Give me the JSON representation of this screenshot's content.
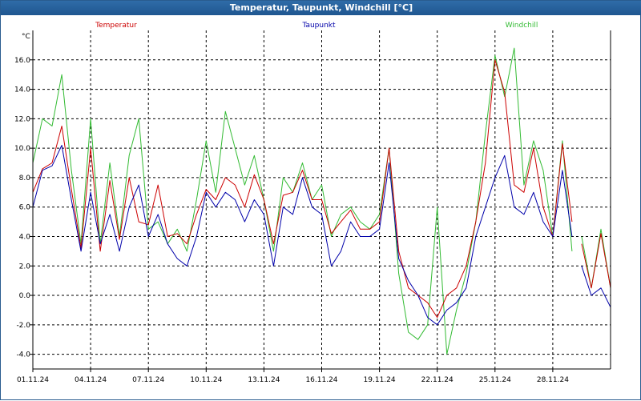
{
  "window": {
    "title": "Temperatur, Taupunkt, Windchill [°C]"
  },
  "colors": {
    "temperature": "#cc0000",
    "dewpoint": "#0000aa",
    "windchill": "#33bb33",
    "grid": "#000000",
    "title_bar": "#1f5690"
  },
  "chart_data": {
    "type": "line",
    "title": "Temperatur, Taupunkt, Windchill [°C]",
    "ylabel": "°C",
    "xlabel": "",
    "ylim": [
      -5,
      18
    ],
    "xlim": [
      "01.11.24 00:00",
      "01.12.24 00:00"
    ],
    "grid": true,
    "legend_position": "top",
    "x_ticks": [
      "01.11.24",
      "04.11.24",
      "07.11.24",
      "10.11.24",
      "13.11.24",
      "16.11.24",
      "19.11.24",
      "22.11.24",
      "25.11.24",
      "28.11.24"
    ],
    "y_ticks": [
      "-4.0",
      "-2.0",
      "0.0",
      "2.0",
      "4.0",
      "6.0",
      "8.0",
      "10.0",
      "12.0",
      "14.0",
      "16.0"
    ],
    "series": [
      {
        "name": "Temperatur",
        "x": [
          "01.11.24 00:00",
          "01.11.24 12:00",
          "02.11.24 00:00",
          "02.11.24 12:00",
          "03.11.24 00:00",
          "03.11.24 12:00",
          "04.11.24 00:00",
          "04.11.24 12:00",
          "05.11.24 00:00",
          "05.11.24 12:00",
          "06.11.24 00:00",
          "06.11.24 12:00",
          "07.11.24 00:00",
          "07.11.24 12:00",
          "08.11.24 00:00",
          "08.11.24 12:00",
          "09.11.24 00:00",
          "09.11.24 12:00",
          "10.11.24 00:00",
          "10.11.24 12:00",
          "11.11.24 00:00",
          "11.11.24 12:00",
          "12.11.24 00:00",
          "12.11.24 12:00",
          "13.11.24 00:00",
          "13.11.24 12:00",
          "14.11.24 00:00",
          "14.11.24 12:00",
          "15.11.24 00:00",
          "15.11.24 12:00",
          "16.11.24 00:00",
          "16.11.24 12:00",
          "17.11.24 00:00",
          "17.11.24 12:00",
          "18.11.24 00:00",
          "18.11.24 12:00",
          "19.11.24 00:00",
          "19.11.24 12:00",
          "20.11.24 00:00",
          "20.11.24 12:00",
          "21.11.24 00:00",
          "21.11.24 12:00",
          "22.11.24 00:00",
          "22.11.24 12:00",
          "23.11.24 00:00",
          "23.11.24 12:00",
          "24.11.24 00:00",
          "24.11.24 12:00",
          "25.11.24 00:00",
          "25.11.24 12:00",
          "26.11.24 00:00",
          "26.11.24 12:00",
          "27.11.24 00:00",
          "27.11.24 12:00",
          "28.11.24 00:00",
          "28.11.24 12:00",
          "29.11.24 00:00",
          null,
          "29.11.24 12:00",
          "30.11.24 00:00",
          "30.11.24 12:00",
          "01.12.24 00:00"
        ],
        "values": [
          7.0,
          8.6,
          9.0,
          11.5,
          7.2,
          3.2,
          10.0,
          3.0,
          7.8,
          3.8,
          8.0,
          5.0,
          4.8,
          7.5,
          4.0,
          4.2,
          3.5,
          5.5,
          7.2,
          6.5,
          8.0,
          7.5,
          6.0,
          8.2,
          6.5,
          3.5,
          6.8,
          7.0,
          8.5,
          6.5,
          6.5,
          4.2,
          5.0,
          5.8,
          4.5,
          4.5,
          5.0,
          10.0,
          3.0,
          0.5,
          0.0,
          -0.5,
          -1.5,
          0.0,
          0.5,
          2.0,
          5.0,
          9.0,
          16.0,
          13.8,
          7.5,
          7.0,
          10.0,
          6.0,
          4.0,
          10.3,
          5.0,
          null,
          3.5,
          0.5,
          4.2,
          0.5
        ]
      },
      {
        "name": "Taupunkt",
        "x": [
          "01.11.24 00:00",
          "01.11.24 12:00",
          "02.11.24 00:00",
          "02.11.24 12:00",
          "03.11.24 00:00",
          "03.11.24 12:00",
          "04.11.24 00:00",
          "04.11.24 12:00",
          "05.11.24 00:00",
          "05.11.24 12:00",
          "06.11.24 00:00",
          "06.11.24 12:00",
          "07.11.24 00:00",
          "07.11.24 12:00",
          "08.11.24 00:00",
          "08.11.24 12:00",
          "09.11.24 00:00",
          "09.11.24 12:00",
          "10.11.24 00:00",
          "10.11.24 12:00",
          "11.11.24 00:00",
          "11.11.24 12:00",
          "12.11.24 00:00",
          "12.11.24 12:00",
          "13.11.24 00:00",
          "13.11.24 12:00",
          "14.11.24 00:00",
          "14.11.24 12:00",
          "15.11.24 00:00",
          "15.11.24 12:00",
          "16.11.24 00:00",
          "16.11.24 12:00",
          "17.11.24 00:00",
          "17.11.24 12:00",
          "18.11.24 00:00",
          "18.11.24 12:00",
          "19.11.24 00:00",
          "19.11.24 12:00",
          "20.11.24 00:00",
          "20.11.24 12:00",
          "21.11.24 00:00",
          "21.11.24 12:00",
          "22.11.24 00:00",
          "22.11.24 12:00",
          "23.11.24 00:00",
          "23.11.24 12:00",
          "24.11.24 00:00",
          "24.11.24 12:00",
          "25.11.24 00:00",
          "25.11.24 12:00",
          "26.11.24 00:00",
          "26.11.24 12:00",
          "27.11.24 00:00",
          "27.11.24 12:00",
          "28.11.24 00:00",
          "28.11.24 12:00",
          "29.11.24 00:00",
          null,
          "29.11.24 12:00",
          "30.11.24 00:00",
          "30.11.24 12:00",
          "01.12.24 00:00"
        ],
        "values": [
          6.0,
          8.5,
          8.8,
          10.2,
          6.5,
          3.0,
          7.0,
          3.5,
          5.5,
          3.0,
          6.0,
          7.5,
          4.0,
          5.5,
          3.5,
          2.5,
          2.0,
          4.0,
          7.0,
          6.0,
          7.0,
          6.5,
          5.0,
          6.5,
          5.5,
          2.0,
          6.0,
          5.5,
          8.0,
          6.0,
          5.5,
          2.0,
          3.0,
          5.0,
          4.0,
          4.0,
          4.5,
          9.0,
          2.5,
          1.0,
          0.0,
          -1.5,
          -2.0,
          -1.0,
          -0.5,
          0.5,
          4.0,
          6.0,
          8.0,
          9.5,
          6.0,
          5.5,
          7.0,
          5.0,
          4.0,
          8.5,
          4.0,
          null,
          2.0,
          0.0,
          0.5,
          -0.8
        ]
      },
      {
        "name": "Windchill",
        "x": [
          "01.11.24 00:00",
          "01.11.24 12:00",
          "02.11.24 00:00",
          "02.11.24 12:00",
          "03.11.24 00:00",
          "03.11.24 12:00",
          "04.11.24 00:00",
          "04.11.24 12:00",
          "05.11.24 00:00",
          "05.11.24 12:00",
          "06.11.24 00:00",
          "06.11.24 12:00",
          "07.11.24 00:00",
          "07.11.24 12:00",
          "08.11.24 00:00",
          "08.11.24 12:00",
          "09.11.24 00:00",
          "09.11.24 12:00",
          "10.11.24 00:00",
          "10.11.24 12:00",
          "11.11.24 00:00",
          "11.11.24 12:00",
          "12.11.24 00:00",
          "12.11.24 12:00",
          "13.11.24 00:00",
          "13.11.24 12:00",
          "14.11.24 00:00",
          "14.11.24 12:00",
          "15.11.24 00:00",
          "15.11.24 12:00",
          "16.11.24 00:00",
          "16.11.24 12:00",
          "17.11.24 00:00",
          "17.11.24 12:00",
          "18.11.24 00:00",
          "18.11.24 12:00",
          "19.11.24 00:00",
          "19.11.24 12:00",
          "20.11.24 00:00",
          "20.11.24 12:00",
          "21.11.24 00:00",
          "21.11.24 12:00",
          "22.11.24 00:00",
          "22.11.24 12:00",
          "23.11.24 00:00",
          "23.11.24 12:00",
          "24.11.24 00:00",
          "24.11.24 12:00",
          "25.11.24 00:00",
          "25.11.24 12:00",
          "26.11.24 00:00",
          "26.11.24 12:00",
          "27.11.24 00:00",
          "27.11.24 12:00",
          "28.11.24 00:00",
          "28.11.24 12:00",
          "29.11.24 00:00",
          null,
          "29.11.24 12:00",
          "30.11.24 00:00",
          "30.11.24 12:00",
          "01.12.24 00:00"
        ],
        "values": [
          9.0,
          12.0,
          11.5,
          15.0,
          8.5,
          3.5,
          12.0,
          3.5,
          9.0,
          4.0,
          9.5,
          12.0,
          4.5,
          5.0,
          3.5,
          4.5,
          3.0,
          6.5,
          10.5,
          7.0,
          12.5,
          10.0,
          7.5,
          9.5,
          6.5,
          3.0,
          8.0,
          7.0,
          9.0,
          6.5,
          7.5,
          4.0,
          5.5,
          6.0,
          5.0,
          4.5,
          5.5,
          10.0,
          1.5,
          -2.5,
          -3.0,
          -2.0,
          6.0,
          -4.0,
          -1.0,
          1.5,
          5.0,
          11.0,
          16.3,
          13.5,
          16.8,
          7.5,
          10.5,
          8.5,
          4.0,
          10.5,
          3.0,
          null,
          4.0,
          0.5,
          4.5,
          0.5
        ]
      }
    ]
  }
}
